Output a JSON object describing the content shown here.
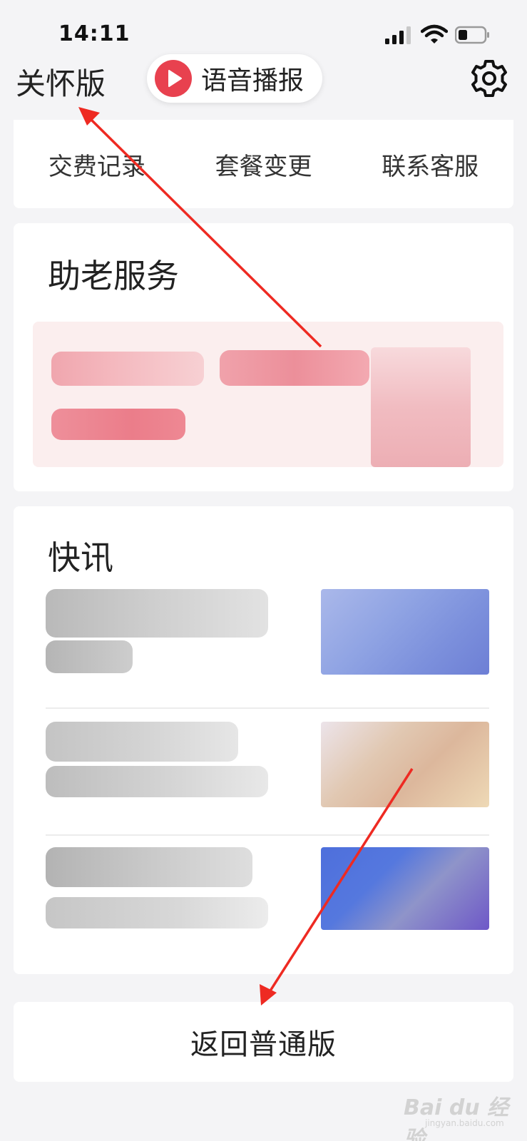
{
  "status_bar": {
    "time": "14:11"
  },
  "header": {
    "care_mode_label": "关怀版",
    "voice_button_label": "语音播报"
  },
  "quick_links": [
    {
      "label": "交费记录"
    },
    {
      "label": "套餐变更"
    },
    {
      "label": "联系客服"
    }
  ],
  "elder_service": {
    "title": "助老服务"
  },
  "news": {
    "title": "快讯"
  },
  "return_button_label": "返回普通版",
  "watermark": {
    "brand": "Bai du 经验",
    "url": "jingyan.baidu.com"
  },
  "colors": {
    "accent": "#e8414f",
    "annotation_arrow": "#ee2a22",
    "page_background": "#f4f4f6"
  }
}
